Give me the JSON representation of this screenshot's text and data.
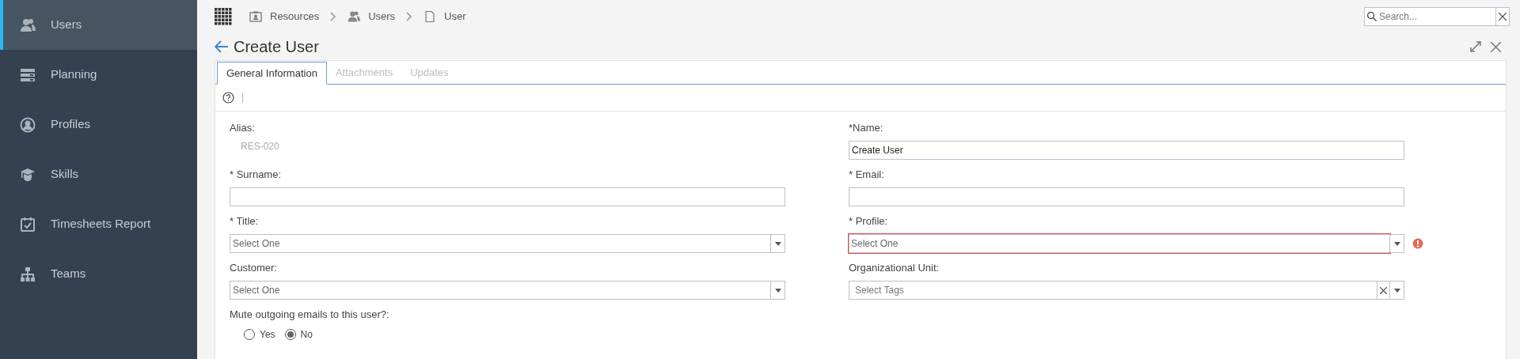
{
  "sidebar": {
    "items": [
      {
        "label": "Users",
        "selected": true
      },
      {
        "label": "Planning",
        "selected": false
      },
      {
        "label": "Profiles",
        "selected": false
      },
      {
        "label": "Skills",
        "selected": false
      },
      {
        "label": "Timesheets Report",
        "selected": false
      },
      {
        "label": "Teams",
        "selected": false
      }
    ]
  },
  "breadcrumb": [
    {
      "label": "Resources"
    },
    {
      "label": "Users"
    },
    {
      "label": "User"
    }
  ],
  "search": {
    "placeholder": "Search..."
  },
  "page_title": "Create User",
  "tabs": [
    {
      "label": "General Information",
      "selected": true
    },
    {
      "label": "Attachments",
      "selected": false
    },
    {
      "label": "Updates",
      "selected": false
    }
  ],
  "form": {
    "left": [
      {
        "kind": "readonly",
        "label": "Alias:",
        "value": "RES-020"
      },
      {
        "kind": "text",
        "label": "* Surname:"
      },
      {
        "kind": "select",
        "label": "* Title:",
        "placeholder": "Select One",
        "invalid": false
      },
      {
        "kind": "select",
        "label": "Customer:",
        "placeholder": "Select One",
        "invalid": false
      },
      {
        "kind": "radio",
        "label": "Mute outgoing emails to this user?:",
        "options": [
          {
            "label": "Yes",
            "selected": false
          },
          {
            "label": "No",
            "selected": true
          }
        ]
      }
    ],
    "right": [
      {
        "kind": "text",
        "label": "*Name:",
        "value": "Create User"
      },
      {
        "kind": "text",
        "label": "* Email:"
      },
      {
        "kind": "select",
        "label": "* Profile:",
        "placeholder": "Select One",
        "invalid": true
      },
      {
        "kind": "tags",
        "label": "Organizational Unit:",
        "placeholder": "Select Tags"
      }
    ]
  }
}
